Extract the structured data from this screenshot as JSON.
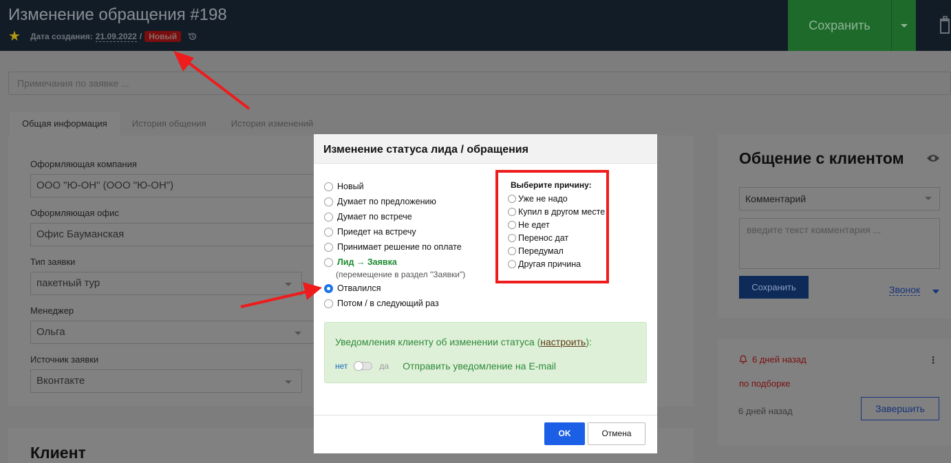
{
  "header": {
    "title": "Изменение обращения #198",
    "created_label": "Дата создания:",
    "created_date": "21.09.2022",
    "separator": "/",
    "status_badge": "Новый",
    "save_label": "Сохранить"
  },
  "notes": {
    "placeholder": "Примечания по заявке ..."
  },
  "tabs": [
    {
      "label": "Общая информация",
      "active": true
    },
    {
      "label": "История общения",
      "active": false
    },
    {
      "label": "История изменений",
      "active": false
    }
  ],
  "form": {
    "company_label": "Оформляющая компания",
    "company_value": "ООО \"Ю-ОН\" (ООО \"Ю-ОН\")",
    "office_label": "Оформляющая офис",
    "office_value": "Офис Бауманская",
    "type_label": "Тип заявки",
    "type_value": "пакетный тур",
    "manager_label": "Менеджер",
    "manager_value": "Ольга",
    "source_label": "Источник заявки",
    "source_value": "Вконтакте"
  },
  "client": {
    "title": "Клиент"
  },
  "communication": {
    "title": "Общение с клиентом",
    "type_value": "Комментарий",
    "comment_placeholder": "введите текст комментария ...",
    "save_label": "Сохранить",
    "call_label": "Звонок"
  },
  "task": {
    "time": "6 дней назад",
    "text": "по подборке",
    "sub_time": "6 дней назад",
    "finish_label": "Завершить"
  },
  "modal": {
    "title": "Изменение статуса лида / обращения",
    "statuses": [
      {
        "label": "Новый",
        "checked": false
      },
      {
        "label": "Думает по предложению",
        "checked": false
      },
      {
        "label": "Думает по встрече",
        "checked": false
      },
      {
        "label": "Приедет на встречу",
        "checked": false
      },
      {
        "label": "Принимает решение по оплате",
        "checked": false
      },
      {
        "label": "Лид → Заявка",
        "checked": false
      },
      {
        "label": "Отвалился",
        "checked": true
      },
      {
        "label": "Потом / в следующий раз",
        "checked": false
      }
    ],
    "lead_note": "(перемещение в раздел \"Заявки\")",
    "reasons_title": "Выберите причину:",
    "reasons": [
      "Уже не надо",
      "Купил в другом месте",
      "Не едет",
      "Перенос дат",
      "Передумал",
      "Другая причина"
    ],
    "notify_text": "Уведомления клиенту об изменении статуса (",
    "notify_link": "настроить",
    "notify_end": "):",
    "toggle_no": "нет",
    "toggle_yes": "да",
    "notify_email": "Отправить уведомление на E-mail",
    "ok_label": "OK",
    "cancel_label": "Отмена"
  },
  "colors": {
    "accent": "#1a5fe6",
    "annotation": "#ee1c1c",
    "lead_green": "#1b8a2f"
  }
}
